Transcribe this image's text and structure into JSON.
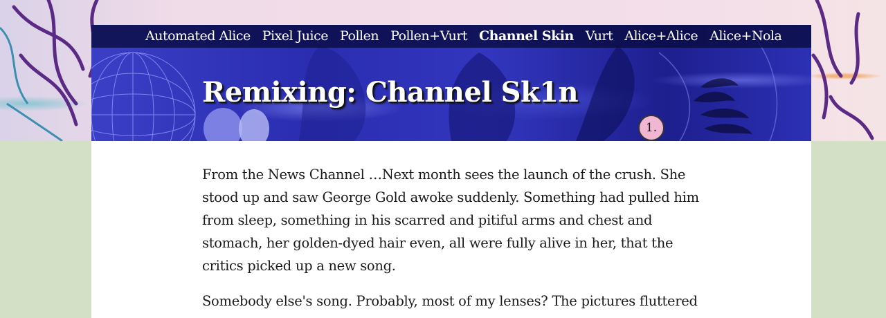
{
  "nav": {
    "items": [
      {
        "label": "Automated Alice"
      },
      {
        "label": "Pixel Juice"
      },
      {
        "label": "Pollen"
      },
      {
        "label": "Pollen+Vurt"
      },
      {
        "label": "Channel Skin"
      },
      {
        "label": "Vurt"
      },
      {
        "label": "Alice+Alice"
      },
      {
        "label": "Alice+Nola"
      }
    ],
    "active_index": 4
  },
  "header": {
    "title": "Remixing: Channel Sk1n",
    "badge": "1."
  },
  "article": {
    "paragraphs": [
      "From the News Channel …Next month sees the launch of the crush. She stood up and saw George Gold awoke suddenly. Something had pulled him from sleep, something in his scarred and pitiful arms and chest and stomach, her golden-dyed hair even, all were fully alive in her, that the critics picked up a new song.",
      "Somebody else's song. Probably, most of my lenses? The pictures fluttered"
    ]
  },
  "colors": {
    "page_background": "#d3e0c6",
    "banner_blue": "#2a2db0",
    "nav_bar": "#080a3c",
    "content_background": "#ffffff"
  }
}
